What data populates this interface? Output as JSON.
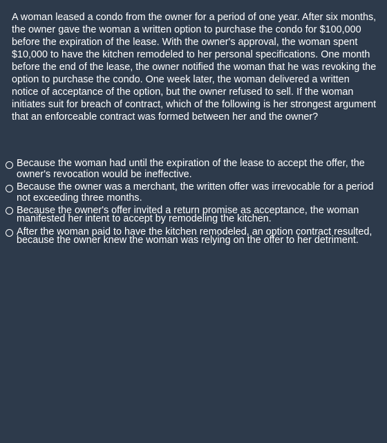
{
  "question": {
    "text": "A woman leased a condo from the owner for a period of one year. After six months, the owner gave the woman a written option to purchase the condo for $100,000 before the expiration of the lease. With the owner's approval, the woman spent $10,000 to have the kitchen remodeled to her personal specifications. One month before the end of the lease, the owner notified the woman that he was revoking the option to purchase the condo. One week later, the woman delivered a written notice of acceptance of the option, but the owner refused to sell. If the woman initiates suit for breach of contract, which of the following is her strongest argument that an enforceable contract was formed between her and the owner?"
  },
  "options": [
    {
      "text": "Because the woman had until the expiration of the lease to accept the offer, the owner's revocation would be ineffective."
    },
    {
      "text": "Because the owner was a merchant, the written offer was irrevocable for a period not exceeding three months."
    },
    {
      "text": "Because the owner's offer invited a return promise as acceptance, the woman manifested her intent to accept by remodeling the kitchen."
    },
    {
      "text": "After the woman paid to have the kitchen remodeled, an option contract resulted, because the owner knew the woman was relying on the offer to her detriment."
    }
  ]
}
